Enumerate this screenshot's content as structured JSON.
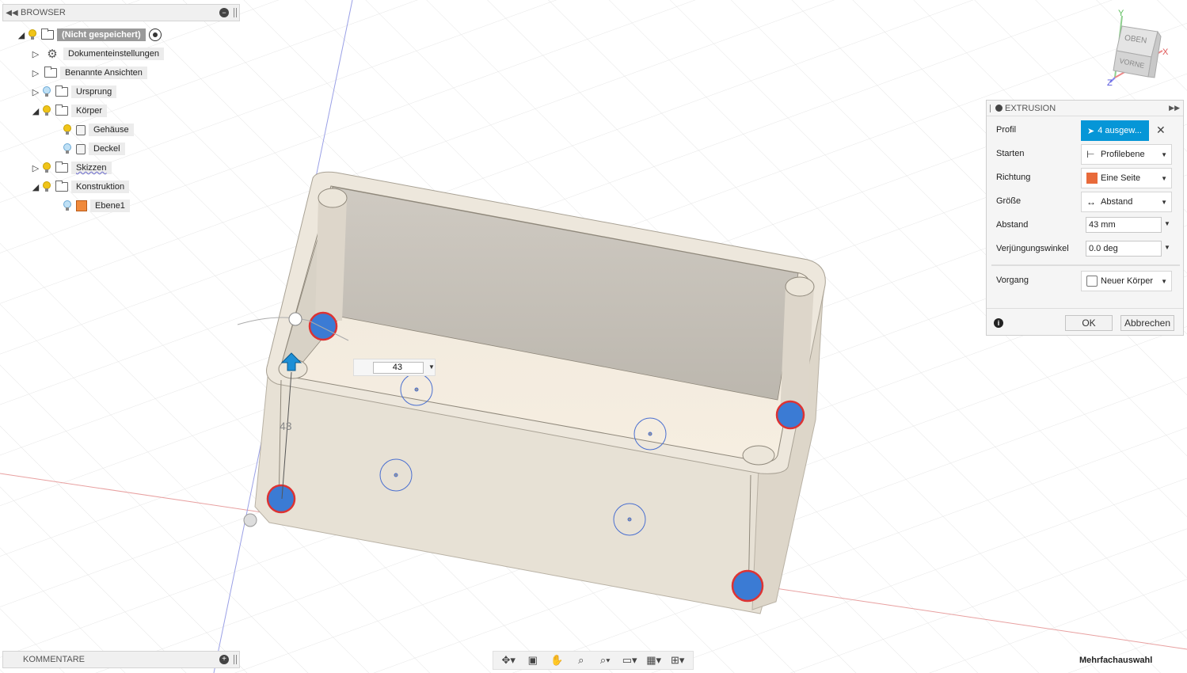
{
  "browser": {
    "title": "BROWSER",
    "root": "(Nicht gespeichert)",
    "items": [
      {
        "label": "Dokumenteinstellungen"
      },
      {
        "label": "Benannte Ansichten"
      },
      {
        "label": "Ursprung"
      },
      {
        "label": "Körper"
      },
      {
        "label": "Gehäuse"
      },
      {
        "label": "Deckel"
      },
      {
        "label": "Skizzen"
      },
      {
        "label": "Konstruktion"
      },
      {
        "label": "Ebene1"
      }
    ]
  },
  "comments": {
    "title": "KOMMENTARE"
  },
  "viewcube": {
    "top": "OBEN",
    "front": "VORNE",
    "axis_x": "X",
    "axis_y": "Y",
    "axis_z": "Z"
  },
  "extrusion": {
    "title": "EXTRUSION",
    "rows": [
      {
        "label": "Profil",
        "value": "4 ausgew..."
      },
      {
        "label": "Starten",
        "value": "Profilebene"
      },
      {
        "label": "Richtung",
        "value": "Eine Seite"
      },
      {
        "label": "Größe",
        "value": "Abstand"
      },
      {
        "label": "Abstand",
        "value": "43 mm"
      },
      {
        "label": "Verjüngungswinkel",
        "value": "0.0 deg"
      },
      {
        "label": "Vorgang",
        "value": "Neuer Körper"
      }
    ],
    "ok": "OK",
    "cancel": "Abbrechen"
  },
  "canvas": {
    "distance_input": "43",
    "dimension_label": "43"
  },
  "status": "Mehrfachauswahl",
  "colors": {
    "accent": "#0696d7",
    "grid": "#e6e6e6",
    "body": "#e8e2d6",
    "selection": "#3b7bd4"
  }
}
